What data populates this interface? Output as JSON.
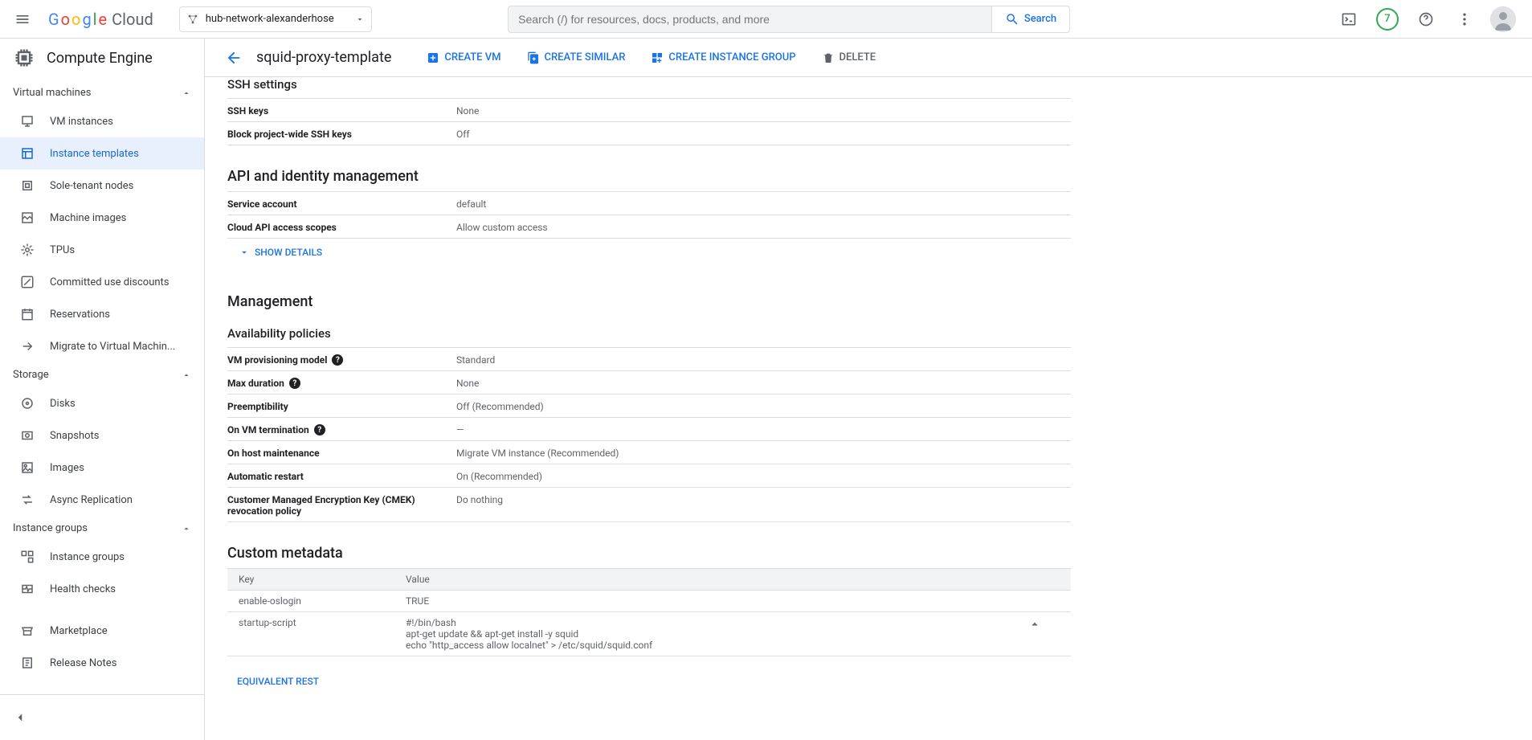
{
  "topbar": {
    "logo_cloud": "Cloud",
    "project": "hub-network-alexanderhose",
    "search_placeholder": "Search (/) for resources, docs, products, and more",
    "search_btn": "Search",
    "badge": "7"
  },
  "sidebar": {
    "title": "Compute Engine",
    "groups": {
      "vm": "Virtual machines",
      "storage": "Storage",
      "ig": "Instance groups"
    },
    "items": {
      "vm_instances": "VM instances",
      "instance_templates": "Instance templates",
      "sole_tenant": "Sole-tenant nodes",
      "machine_images": "Machine images",
      "tpus": "TPUs",
      "committed": "Committed use discounts",
      "reservations": "Reservations",
      "migrate": "Migrate to Virtual Machin...",
      "disks": "Disks",
      "snapshots": "Snapshots",
      "images": "Images",
      "async": "Async Replication",
      "inst_groups": "Instance groups",
      "health": "Health checks",
      "marketplace": "Marketplace",
      "release": "Release Notes"
    }
  },
  "actions": {
    "title": "squid-proxy-template",
    "create_vm": "CREATE VM",
    "create_similar": "CREATE SIMILAR",
    "create_ig": "CREATE INSTANCE GROUP",
    "delete": "DELETE"
  },
  "content": {
    "ssh": {
      "title": "SSH settings",
      "keys_k": "SSH keys",
      "keys_v": "None",
      "block_k": "Block project-wide SSH keys",
      "block_v": "Off"
    },
    "api": {
      "title": "API and identity management",
      "svc_k": "Service account",
      "svc_v": "default",
      "scope_k": "Cloud API access scopes",
      "scope_v": "Allow custom access",
      "show_details": "SHOW DETAILS"
    },
    "mgmt": {
      "title": "Management",
      "avail": "Availability policies",
      "prov_k": "VM provisioning model",
      "prov_v": "Standard",
      "maxd_k": "Max duration",
      "maxd_v": "None",
      "preempt_k": "Preemptibility",
      "preempt_v": "Off (Recommended)",
      "term_k": "On VM termination",
      "term_v": "—",
      "host_k": "On host maintenance",
      "host_v": "Migrate VM instance (Recommended)",
      "auto_k": "Automatic restart",
      "auto_v": "On (Recommended)",
      "cmek_k": "Customer Managed Encryption Key (CMEK) revocation policy",
      "cmek_v": "Do nothing"
    },
    "meta": {
      "title": "Custom metadata",
      "col_key": "Key",
      "col_val": "Value",
      "rows": [
        {
          "key": "enable-oslogin",
          "val": "TRUE"
        },
        {
          "key": "startup-script",
          "val": "#!/bin/bash\napt-get update && apt-get install -y squid\necho \"http_access allow localnet\" > /etc/squid/squid.conf"
        }
      ]
    },
    "eq_rest": "EQUIVALENT REST"
  }
}
